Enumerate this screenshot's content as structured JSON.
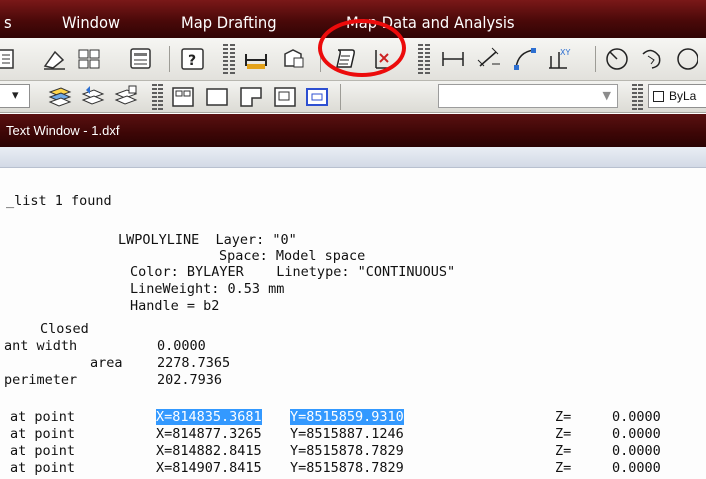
{
  "menubar": {
    "items": [
      "s",
      "Window",
      "Map Drafting",
      "Map Data and Analysis"
    ]
  },
  "toolbar": {
    "bylayer_label": "ByLa"
  },
  "text_window": {
    "title": "Text Window - 1.dxf"
  },
  "output": {
    "found_line": "_list 1 found",
    "entity_line": "LWPOLYLINE  Layer: \"0\"",
    "space_line": "Space: Model space",
    "color_line": "Color: BYLAYER    Linetype: \"CONTINUOUS\"",
    "lineweight_line": "LineWeight: 0.53 mm",
    "handle_line": "Handle = b2",
    "closed_label": "Closed",
    "width_label": "ant width",
    "width_value": "0.0000",
    "area_label": "area",
    "area_value": "2278.7365",
    "perimeter_label": "perimeter",
    "perimeter_value": "202.7936",
    "points": [
      {
        "label": "at point",
        "x": "X=814835.3681",
        "y": "Y=8515859.9310",
        "zl": "Z=",
        "z": "0.0000"
      },
      {
        "label": "at point",
        "x": "X=814877.3265",
        "y": "Y=8515887.1246",
        "zl": "Z=",
        "z": "0.0000"
      },
      {
        "label": "at point",
        "x": "X=814882.8415",
        "y": "Y=8515878.7829",
        "zl": "Z=",
        "z": "0.0000"
      },
      {
        "label": "at point",
        "x": "X=814907.8415",
        "y": "Y=8515878.7829",
        "zl": "Z=",
        "z": "0.0000"
      }
    ]
  }
}
